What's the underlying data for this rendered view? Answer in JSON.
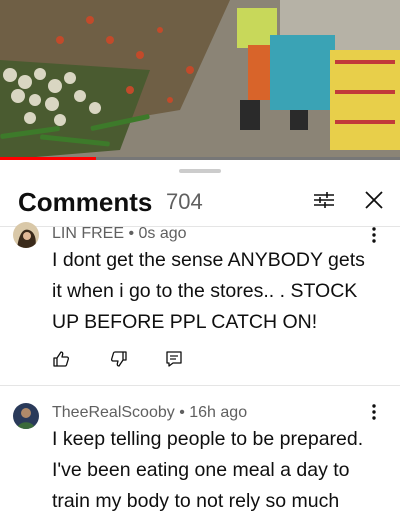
{
  "comments_header": {
    "title": "Comments",
    "count": "704"
  },
  "progress": {
    "fraction": 0.24
  },
  "colors": {
    "progress": "#ff0000",
    "text": "#0f0f0f",
    "meta": "#606060"
  },
  "icons": [
    "filter-icon",
    "close-icon",
    "more-vert-icon",
    "thumbs-up-icon",
    "thumbs-down-icon",
    "reply-icon"
  ],
  "comments": [
    {
      "author": "LIN FREE",
      "time": "0s ago",
      "lines": [
        "I dont get the sense ANYBODY gets",
        "it when i go to the stores.. . STOCK",
        "UP BEFORE PPL CATCH ON!"
      ]
    },
    {
      "author": "TheeRealScooby",
      "time": "16h ago",
      "lines": [
        "I keep telling people to be prepared.",
        "I've been eating one meal a day to",
        "train my body to not rely so much"
      ]
    }
  ]
}
